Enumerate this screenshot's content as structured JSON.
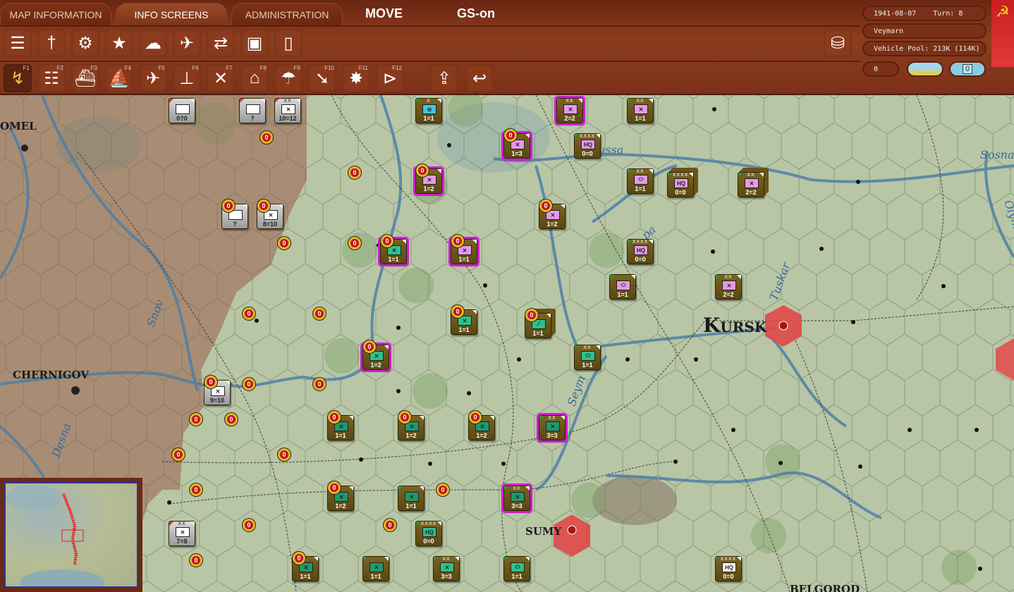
{
  "tabs": [
    {
      "label": "MAP INFORMATION"
    },
    {
      "label": "INFO SCREENS"
    },
    {
      "label": "ADMINISTRATION"
    }
  ],
  "mode": "MOVE",
  "gs": "GS-on",
  "toolbar1": [
    {
      "icon": "unit-list-icon",
      "g": "☰"
    },
    {
      "icon": "losses-icon",
      "g": "†"
    },
    {
      "icon": "production-icon",
      "g": "⚙"
    },
    {
      "icon": "leaders-icon",
      "g": "★"
    },
    {
      "icon": "weather-icon",
      "g": "☁"
    },
    {
      "icon": "air-war-icon",
      "g": "✈"
    },
    {
      "icon": "air-transfer-icon",
      "g": "⇄"
    },
    {
      "icon": "report-flag-icon",
      "g": "▣"
    },
    {
      "icon": "report-blank-icon",
      "g": "▯"
    }
  ],
  "toolbar2": [
    {
      "icon": "move-path-icon",
      "g": "↯",
      "key": "F1"
    },
    {
      "icon": "rail-icon",
      "g": "☷",
      "key": "F2"
    },
    {
      "icon": "naval-transport-icon",
      "g": "⛴",
      "key": "F3"
    },
    {
      "icon": "naval-icon",
      "g": "⛵",
      "key": "F4"
    },
    {
      "icon": "air-recon-icon",
      "g": "✈",
      "key": "F5"
    },
    {
      "icon": "ground-bomb-icon",
      "g": "⊥",
      "key": "F6"
    },
    {
      "icon": "airfield-bomb-icon",
      "g": "✕",
      "key": "F7"
    },
    {
      "icon": "city-bomb-icon",
      "g": "⌂",
      "key": "F8"
    },
    {
      "icon": "paradrop-icon",
      "g": "☂",
      "key": "F9"
    },
    {
      "icon": "air-transport-icon",
      "g": "➘",
      "key": "F10"
    },
    {
      "icon": "explosion-icon",
      "g": "✸",
      "key": "F11"
    },
    {
      "icon": "next-unit-icon",
      "g": "⊳",
      "key": "F12"
    }
  ],
  "toolbar_extra": [
    {
      "icon": "upload-icon",
      "g": "⇪"
    },
    {
      "icon": "undo-icon",
      "g": "↩"
    }
  ],
  "db_icon": "⛁",
  "status": {
    "date": "1941-08-07",
    "turn": "Turn: 8",
    "leader": "Veymarn",
    "vehicle_pool": "Vehicle Pool: 213K (114K)",
    "counter": "0",
    "badge": "0"
  },
  "flag": "☭",
  "cities": [
    {
      "name": "OMEL"
    },
    {
      "name": "CHERNIGOV"
    },
    {
      "name": "Kursk"
    },
    {
      "name": "SUMY"
    },
    {
      "name": "BELGOROD"
    }
  ],
  "rivers": [
    {
      "name": "ussa"
    },
    {
      "name": "Sosna"
    },
    {
      "name": "Tuskar"
    },
    {
      "name": "Snov"
    },
    {
      "name": "Seym"
    },
    {
      "name": "Desna"
    },
    {
      "name": "Olym"
    },
    {
      "name": "pa"
    }
  ],
  "units": [
    {
      "c": "gray",
      "sz": "",
      "sym": "",
      "st": "0?0"
    },
    {
      "c": "gray",
      "sz": "",
      "sym": "",
      "st": "?"
    },
    {
      "c": "gray",
      "sz": "XX",
      "sym": "✕",
      "st": "10=12"
    },
    {
      "c": "#3ec6e8",
      "sz": "X",
      "sym": "⊖",
      "st": "1=1"
    },
    {
      "c": "#e49ae8",
      "sz": "XX",
      "sym": "✕",
      "st": "2=2",
      "m": 1
    },
    {
      "c": "#e49ae8",
      "sz": "XX",
      "sym": "✕",
      "st": "1=1"
    },
    {
      "c": "#e49ae8",
      "sz": "",
      "sym": "✕",
      "st": "1=3",
      "m": 1,
      "b": 1
    },
    {
      "c": "#e49ae8",
      "sz": "XXXX",
      "sym": "HQ",
      "st": "0=0"
    },
    {
      "c": "#e49ae8",
      "sz": "",
      "sym": "✕",
      "st": "1=2",
      "m": 1,
      "b": 1
    },
    {
      "c": "#e49ae8",
      "sz": "XX",
      "sym": "⬭",
      "st": "1=1"
    },
    {
      "c": "#e49ae8",
      "sz": "XXXX",
      "sym": "HQ",
      "st": "0=0",
      "s": 1
    },
    {
      "c": "#e49ae8",
      "sz": "XX",
      "sym": "✕",
      "st": "2=2",
      "s": 1
    },
    {
      "c": "gray",
      "sz": "",
      "sym": "",
      "st": "?",
      "b": 1
    },
    {
      "c": "gray",
      "sz": "",
      "sym": "✕",
      "st": "8=10",
      "b": 1
    },
    {
      "c": "#e49ae8",
      "sz": "",
      "sym": "✕",
      "st": "1=2",
      "b": 1
    },
    {
      "c": "#2fc08a",
      "sz": "",
      "sym": "✕",
      "st": "1=1",
      "m": 1,
      "b": 1
    },
    {
      "c": "#e49ae8",
      "sz": "",
      "sym": "✕",
      "st": "1=1",
      "m": 1,
      "b": 1
    },
    {
      "c": "#e49ae8",
      "sz": "XXXX",
      "sym": "HQ",
      "st": "0=0"
    },
    {
      "c": "#e49ae8",
      "sz": "",
      "sym": "⬭",
      "st": "1=1"
    },
    {
      "c": "#e49ae8",
      "sz": "XX",
      "sym": "✕",
      "st": "2=2"
    },
    {
      "c": "#2fc08a",
      "sz": "",
      "sym": "✕",
      "st": "1=1",
      "b": 1
    },
    {
      "c": "#2fc08a",
      "sz": "",
      "sym": "⟋",
      "st": "1=1",
      "b": 1,
      "s": 1
    },
    {
      "c": "#2fc08a",
      "sz": "XX",
      "sym": "⬭",
      "st": "1=1"
    },
    {
      "c": "#2fc08a",
      "sz": "",
      "sym": "✕",
      "st": "1=2",
      "m": 1,
      "b": 1
    },
    {
      "c": "gray",
      "sz": "",
      "sym": "✕",
      "st": "9=10",
      "b": 1
    },
    {
      "c": "#1e9a6a",
      "sz": "",
      "sym": "✕",
      "st": "1=1",
      "b": 1
    },
    {
      "c": "#1e9a6a",
      "sz": "",
      "sym": "✕",
      "st": "1=2",
      "b": 1
    },
    {
      "c": "#1e9a6a",
      "sz": "",
      "sym": "✕",
      "st": "1=2",
      "b": 1
    },
    {
      "c": "#1e9a6a",
      "sz": "XX",
      "sym": "✕",
      "st": "3=3",
      "m": 1
    },
    {
      "c": "#1e9a6a",
      "sz": "",
      "sym": "✕",
      "st": "1=2",
      "b": 1
    },
    {
      "c": "#1e9a6a",
      "sz": "",
      "sym": "✕",
      "st": "1=1"
    },
    {
      "c": "#1e9a6a",
      "sz": "XX",
      "sym": "✕",
      "st": "3=3",
      "m": 1
    },
    {
      "c": "#2fc08a",
      "sz": "XXXX",
      "sym": "HQ",
      "st": "0=0"
    },
    {
      "c": "gray",
      "sz": "XX",
      "sym": "✕",
      "st": "7=8"
    },
    {
      "c": "#1e9a6a",
      "sz": "",
      "sym": "✕",
      "st": "1=1",
      "b": 1
    },
    {
      "c": "#1e9a6a",
      "sz": "",
      "sym": "✕",
      "st": "1=1"
    },
    {
      "c": "#2fc08a",
      "sz": "XX",
      "sym": "✕",
      "st": "3=3"
    },
    {
      "c": "#2fc08a",
      "sz": "",
      "sym": "⬭",
      "st": "1=1"
    },
    {
      "c": "#ffffff",
      "sz": "XXXX",
      "sym": "HQ",
      "st": "0=0"
    }
  ],
  "badge_label": "0",
  "badge_count": 17
}
